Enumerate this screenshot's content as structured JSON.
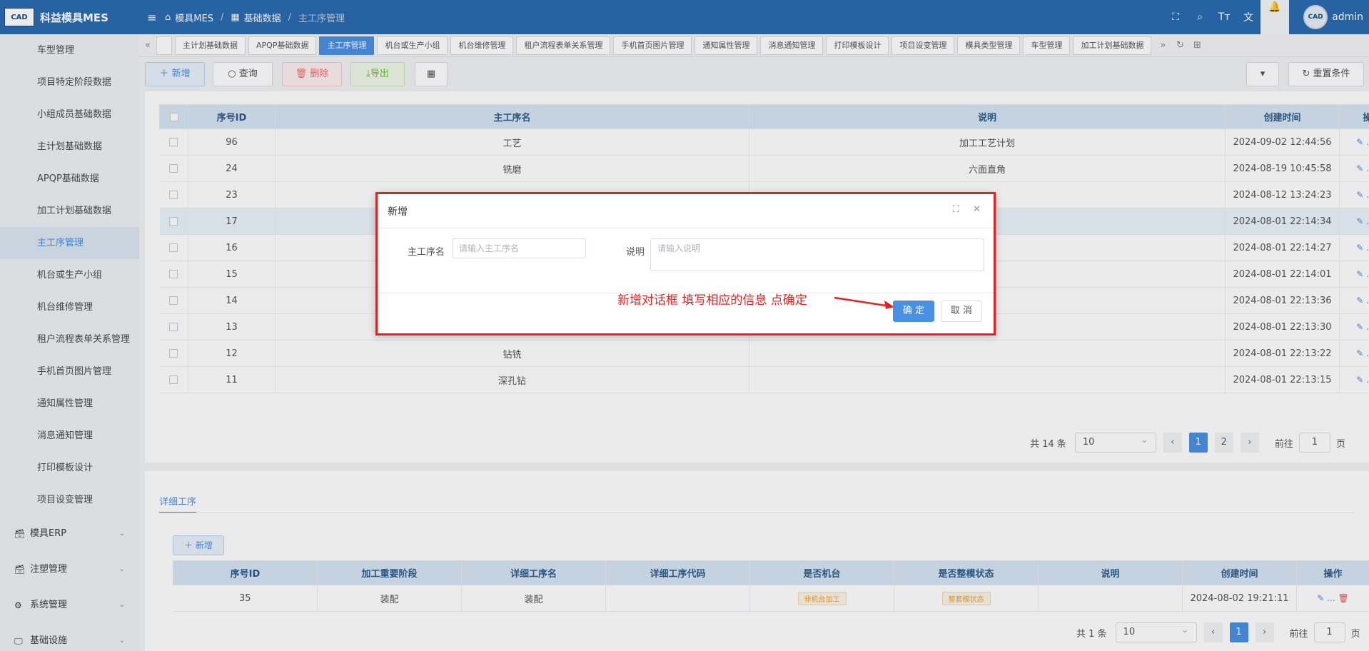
{
  "app": {
    "logo_text": "CAD",
    "title": "科益模具MES"
  },
  "sidebar": {
    "items": [
      {
        "label": "车型管理"
      },
      {
        "label": "项目特定阶段数据"
      },
      {
        "label": "小组成员基础数据"
      },
      {
        "label": "主计划基础数据"
      },
      {
        "label": "APQP基础数据"
      },
      {
        "label": "加工计划基础数据"
      },
      {
        "label": "主工序管理"
      },
      {
        "label": "机台或生产小组"
      },
      {
        "label": "机台维修管理"
      },
      {
        "label": "租户流程表单关系管理"
      },
      {
        "label": "手机首页图片管理"
      },
      {
        "label": "通知属性管理"
      },
      {
        "label": "消息通知管理"
      },
      {
        "label": "打印模板设计"
      },
      {
        "label": "项目设变管理"
      }
    ],
    "groups": [
      {
        "label": "模具ERP"
      },
      {
        "label": "注塑管理"
      },
      {
        "label": "系统管理"
      },
      {
        "label": "基础设施"
      }
    ]
  },
  "header": {
    "breadcrumb": [
      "模具MES",
      "基础数据",
      "主工序管理"
    ],
    "user": "admin",
    "avatar_text": "CAD"
  },
  "tabs": [
    "主计划基础数据",
    "APQP基础数据",
    "主工序管理",
    "机台或生产小组",
    "机台维修管理",
    "租户流程表单关系管理",
    "手机首页图片管理",
    "通知属性管理",
    "消息通知管理",
    "打印模板设计",
    "项目设变管理",
    "模具类型管理",
    "车型管理",
    "加工计划基础数据"
  ],
  "toolbar": {
    "add": "新增",
    "query": "查询",
    "delete": "删除",
    "export": "导出",
    "reset": "重置条件"
  },
  "main_table": {
    "headers": [
      "序号ID",
      "主工序名",
      "说明",
      "创建时间",
      "操作"
    ],
    "rows": [
      {
        "id": "96",
        "name": "工艺",
        "desc": "加工工艺计划",
        "time": "2024-09-02 12:44:56"
      },
      {
        "id": "24",
        "name": "铣磨",
        "desc": "六面直角",
        "time": "2024-08-19 10:45:58"
      },
      {
        "id": "23",
        "name": "",
        "desc": "",
        "time": "2024-08-12 13:24:23"
      },
      {
        "id": "17",
        "name": "",
        "desc": "",
        "time": "2024-08-01 22:14:34"
      },
      {
        "id": "16",
        "name": "",
        "desc": "",
        "time": "2024-08-01 22:14:27"
      },
      {
        "id": "15",
        "name": "",
        "desc": "",
        "time": "2024-08-01 22:14:01"
      },
      {
        "id": "14",
        "name": "",
        "desc": "",
        "time": "2024-08-01 22:13:36"
      },
      {
        "id": "13",
        "name": "",
        "desc": "",
        "time": "2024-08-01 22:13:30"
      },
      {
        "id": "12",
        "name": "钻铣",
        "desc": "",
        "time": "2024-08-01 22:13:22"
      },
      {
        "id": "11",
        "name": "深孔钻",
        "desc": "",
        "time": "2024-08-01 22:13:15"
      }
    ],
    "ops_more": "..."
  },
  "pager1": {
    "total": "共 14 条",
    "size": "10",
    "pages": [
      "1",
      "2"
    ],
    "goto": "前往",
    "goto_val": "1",
    "page_unit": "页"
  },
  "detail": {
    "tab": "详细工序",
    "add": "新增",
    "headers": [
      "序号ID",
      "加工重要阶段",
      "详细工序名",
      "详细工序代码",
      "是否机台",
      "是否整模状态",
      "说明",
      "创建时间",
      "操作"
    ],
    "rows": [
      {
        "id": "35",
        "stage": "装配",
        "name": "装配",
        "code": "",
        "machine": "非机台加工",
        "whole": "整套模状态",
        "desc": "",
        "time": "2024-08-02 19:21:11"
      }
    ]
  },
  "pager2": {
    "total": "共 1 条",
    "size": "10",
    "pages": [
      "1"
    ],
    "goto": "前往",
    "goto_val": "1",
    "page_unit": "页"
  },
  "modal": {
    "title": "新增",
    "name_label": "主工序名",
    "name_placeholder": "请输入主工序名",
    "desc_label": "说明",
    "desc_placeholder": "请输入说明",
    "annotation": "新增对话框  填写相应的信息 点确定",
    "ok": "确 定",
    "cancel": "取 消"
  },
  "colors": {
    "primary": "#4a90e2",
    "header": "#2b6cb0",
    "annotation": "#e02424"
  }
}
